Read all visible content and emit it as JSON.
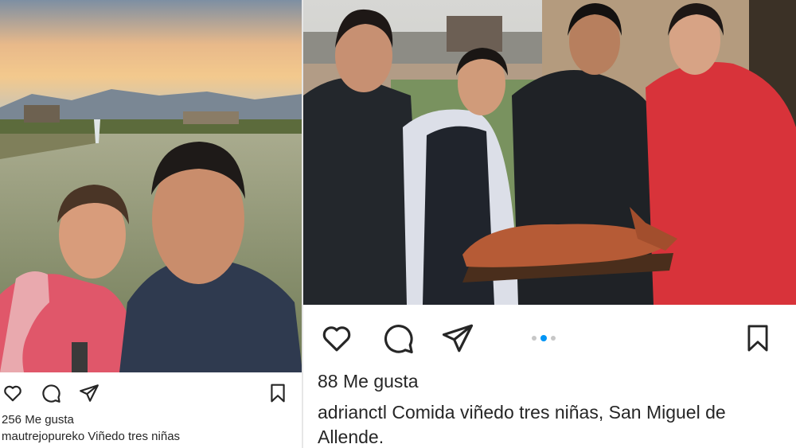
{
  "left_post": {
    "photo_alt": "",
    "icons": {
      "like": "heart-icon",
      "comment": "comment-icon",
      "share": "send-icon",
      "save": "bookmark-icon"
    },
    "likes_text": "256 Me gusta",
    "username": "mautrejopureko",
    "caption": "Viñedo tres niñas"
  },
  "right_post": {
    "icons": {
      "like": "heart-icon",
      "comment": "comment-icon",
      "share": "send-icon",
      "save": "bookmark-icon"
    },
    "carousel": {
      "count": 3,
      "active": 2
    },
    "likes_text": "88 Me gusta",
    "username": "adrianctl",
    "caption": "Comida viñedo tres niñas, San Miguel de Allende."
  },
  "colors": {
    "text": "#262626",
    "carousel_active": "#0095f6",
    "carousel_inactive": "#c7c7c7"
  }
}
